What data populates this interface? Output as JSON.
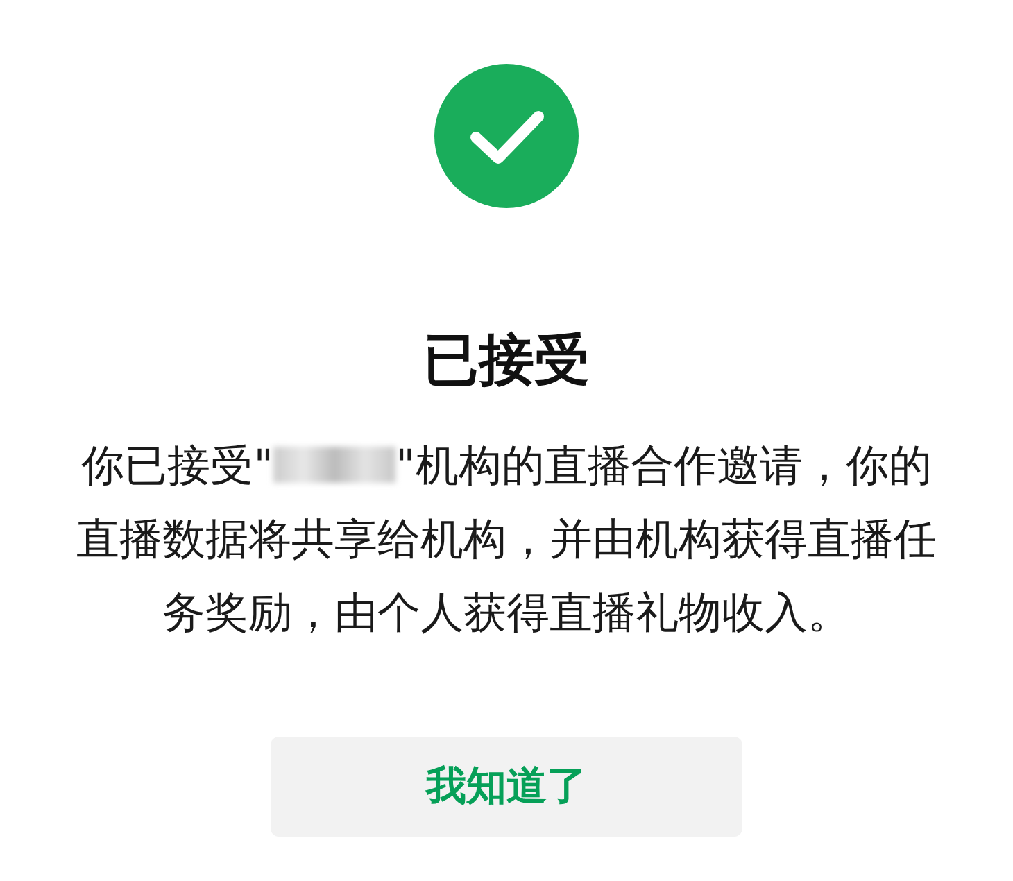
{
  "status_icon": {
    "kind": "success"
  },
  "title": "已接受",
  "message": {
    "before": "你已接受\"",
    "name_redacted": true,
    "after": "\"机构的直播合作邀请，你的直播数据将共享给机构，并由机构获得直播任务奖励，由个人获得直播礼物收入。"
  },
  "button": {
    "label": "我知道了"
  }
}
